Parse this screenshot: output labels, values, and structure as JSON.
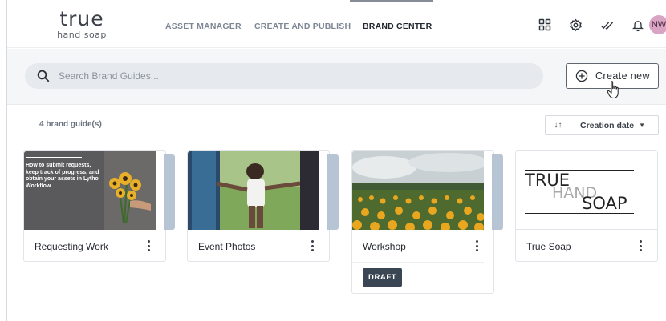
{
  "logo": {
    "word": "true",
    "sub": "hand soap"
  },
  "nav": {
    "items": [
      "ASSET MANAGER",
      "CREATE AND PUBLISH",
      "BRAND CENTER"
    ],
    "active": "BRAND CENTER"
  },
  "header_icons": [
    "apps-grid-icon",
    "gear-icon",
    "double-check-icon",
    "bell-icon"
  ],
  "avatar": {
    "initials": "NW",
    "color": "#d9a3c4"
  },
  "search": {
    "placeholder": "Search Brand Guides..."
  },
  "create_button": {
    "label": "Create new"
  },
  "list": {
    "count_label": "4 brand guide(s)"
  },
  "sort": {
    "direction_glyph": "↓↑",
    "value": "Creation date"
  },
  "cards": [
    {
      "title": "Requesting Work",
      "thumb_text": "How to submit requests, keep track of progress, and obtain your assets in Lytho Workflow"
    },
    {
      "title": "Event Photos"
    },
    {
      "title": "Workshop",
      "badge": "DRAFT"
    },
    {
      "title": "True Soap",
      "thumb_lines": [
        "TRUE",
        "HAND",
        "SOAP"
      ]
    }
  ],
  "colors": {
    "accent_dark": "#3b4654",
    "stack": "#b7c4d3",
    "band": "#f4f6f8"
  }
}
